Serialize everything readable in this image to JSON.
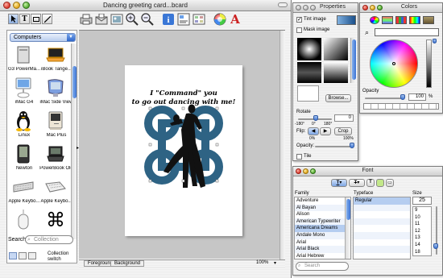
{
  "main_window": {
    "title": "Dancing greeting card...bcard",
    "tools": [
      "arrow-icon",
      "text-tool-icon",
      "rectangle-icon",
      "line-icon"
    ],
    "toolbar_icons": [
      "print-icon",
      "send-icon",
      "picture-icon",
      "zoom-in-icon",
      "zoom-out-icon",
      "info-icon",
      "inspector-icon",
      "browser-icon",
      "color-wheel-icon",
      "font-icon"
    ],
    "library": {
      "category": "Computers",
      "items": [
        {
          "label": "G3 PowerMa...",
          "icon": "g3-powermac-icon"
        },
        {
          "label": "iBook Tange...",
          "icon": "ibook-icon"
        },
        {
          "label": "iMac G4",
          "icon": "imac-g4-icon"
        },
        {
          "label": "iMac Side View",
          "icon": "imac-side-icon"
        },
        {
          "label": "Linux",
          "icon": "linux-penguin-icon"
        },
        {
          "label": "Mac Plus",
          "icon": "mac-plus-icon"
        },
        {
          "label": "Newton",
          "icon": "newton-icon"
        },
        {
          "label": "PowerBook Old",
          "icon": "powerbook-icon"
        },
        {
          "label": "Apple Keybo...",
          "icon": "keyboard-icon"
        },
        {
          "label": "Apple Keybo...",
          "icon": "keyboard-icon"
        },
        {
          "label": "",
          "icon": "mouse-icon"
        },
        {
          "label": "",
          "icon": "command-key-icon"
        }
      ],
      "search_label": "Search:",
      "search_placeholder": "Collection",
      "switch_label": "Collection switch"
    },
    "card": {
      "line1": "I \"Command\" you",
      "line2": "to go out dancing with me!"
    },
    "tabs": [
      "Foreground",
      "Background"
    ],
    "zoom": "100%"
  },
  "properties": {
    "title": "Properties",
    "tint_label": "Tint image",
    "mask_label": "Mask image",
    "browse_label": "Browse...",
    "rotate_label": "Rotate",
    "rotate_value": "0",
    "rotate_ticks": [
      "-180°",
      "0°",
      "180°"
    ],
    "flip_label": "Flip:",
    "crop_label": "Crop",
    "opacity_label": "Opacity:",
    "opacity_ticks": [
      "0%",
      "100%"
    ],
    "tile_label": "Tile"
  },
  "colors": {
    "title": "Colors",
    "opacity_label": "Opacity",
    "opacity_value": "100",
    "opacity_unit": "%"
  },
  "font": {
    "title": "Font",
    "family_header": "Family",
    "typeface_header": "Typeface",
    "size_header": "Size",
    "size_value": "25",
    "families": [
      "Adventure",
      "Al Bayan",
      "Alison",
      "American Typewriter",
      "Americana Dreams",
      "Andale Mono",
      "Arial",
      "Arial Black",
      "Arial Hebrew"
    ],
    "selected_family": "Americana Dreams",
    "typefaces": [
      "Regular"
    ],
    "sizes": [
      "9",
      "10",
      "11",
      "12",
      "13",
      "14",
      "18"
    ],
    "search_placeholder": "Search"
  },
  "colors_palette": {
    "accent": "#3c73d4",
    "design_blue": "#2e6384",
    "selection": "#b5cdf0"
  }
}
